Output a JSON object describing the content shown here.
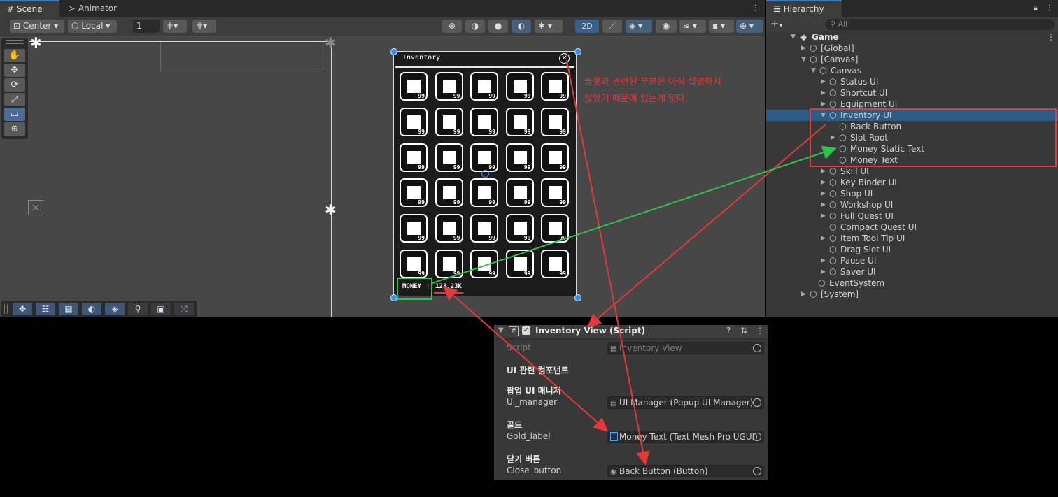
{
  "scene_tabs": {
    "scene": "Scene",
    "animator": "Animator"
  },
  "scene_toolbar": {
    "pivot": "Center",
    "space": "Local",
    "grid_value": "1",
    "mode_2d": "2D"
  },
  "inventory": {
    "title": "Inventory",
    "slot_count": "99",
    "money_label": "MONEY",
    "money_sep": "|",
    "money_value": "123.23K"
  },
  "annotation": {
    "line1": "슬롯과 관련된 부분은 아직 설명하지",
    "line2": "않았기 때문에 없는게 맞다."
  },
  "hierarchy": {
    "tab": "Hierarchy",
    "search_placeholder": "All",
    "root": "Game",
    "items": [
      "[Global]",
      "[Canvas]",
      "Canvas",
      "Status UI",
      "Shortcut UI",
      "Equipment UI",
      "Inventory UI",
      "Back Button",
      "Slot Root",
      "Money Static Text",
      "Money Text",
      "Skill UI",
      "Key Binder UI",
      "Shop UI",
      "Workshop UI",
      "Full Quest UI",
      "Compact Quest UI",
      "Item Tool Tip UI",
      "Drag Slot UI",
      "Pause UI",
      "Saver UI",
      "EventSystem",
      "[System]"
    ]
  },
  "inspector": {
    "component_title": "Inventory View (Script)",
    "script_label": "Script",
    "script_value": "Inventory View",
    "section_ui": "UI 관련 컴포넌트",
    "popup_header": "팝업 UI 매니저",
    "ui_manager_label": "Ui_manager",
    "ui_manager_value": "UI Manager (Popup UI Manager)",
    "gold_header": "골드",
    "gold_label": "Gold_label",
    "gold_value": "Money Text (Text Mesh Pro UGUI)",
    "close_header": "닫기 버튼",
    "close_label": "Close_button",
    "close_value": "Back Button (Button)"
  },
  "colors": {
    "red": "#e03a3a",
    "green": "#2ec24f",
    "selection": "#2c5d87"
  }
}
